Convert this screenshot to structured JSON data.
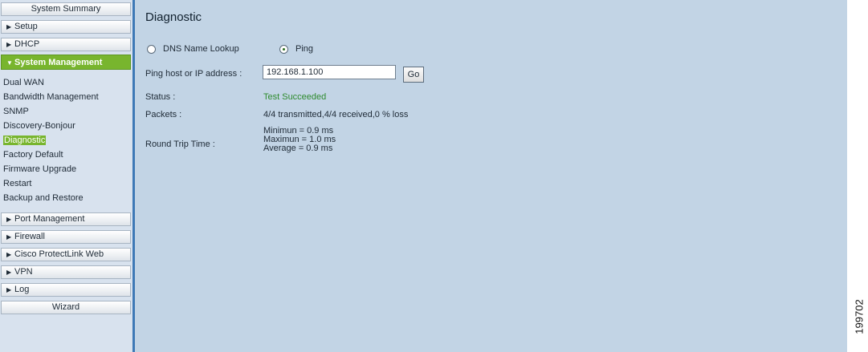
{
  "sidebar": {
    "items": [
      {
        "label": "System Summary"
      },
      {
        "label": "Setup"
      },
      {
        "label": "DHCP"
      },
      {
        "label": "System Management"
      },
      {
        "label": "Port Management"
      },
      {
        "label": "Firewall"
      },
      {
        "label": "Cisco ProtectLink Web"
      },
      {
        "label": "VPN"
      },
      {
        "label": "Log"
      },
      {
        "label": "Wizard"
      }
    ],
    "subitems": [
      {
        "label": "Dual WAN"
      },
      {
        "label": "Bandwidth Management"
      },
      {
        "label": "SNMP"
      },
      {
        "label": "Discovery-Bonjour"
      },
      {
        "label": "Diagnostic"
      },
      {
        "label": "Factory Default"
      },
      {
        "label": "Firmware Upgrade"
      },
      {
        "label": "Restart"
      },
      {
        "label": "Backup and Restore"
      }
    ]
  },
  "main": {
    "title": "Diagnostic",
    "radio_dns": "DNS Name Lookup",
    "radio_ping": "Ping",
    "ping_label": "Ping host or IP address :",
    "ping_value": "192.168.1.100",
    "go_label": "Go",
    "status_label": "Status :",
    "status_value": "Test Succeeded",
    "packets_label": "Packets :",
    "packets_value": "4/4 transmitted,4/4 received,0 % loss",
    "rtt_label": "Round Trip Time :",
    "rtt_min": "Minimun = 0.9 ms",
    "rtt_max": "Maximun = 1.0 ms",
    "rtt_avg": "Average = 0.9 ms"
  },
  "figure_number": "199702",
  "colors": {
    "accent_green": "#78b52e",
    "status_green": "#2e8b2e",
    "main_bg": "#c2d4e5",
    "sidebar_bg": "#d8e2ee"
  }
}
